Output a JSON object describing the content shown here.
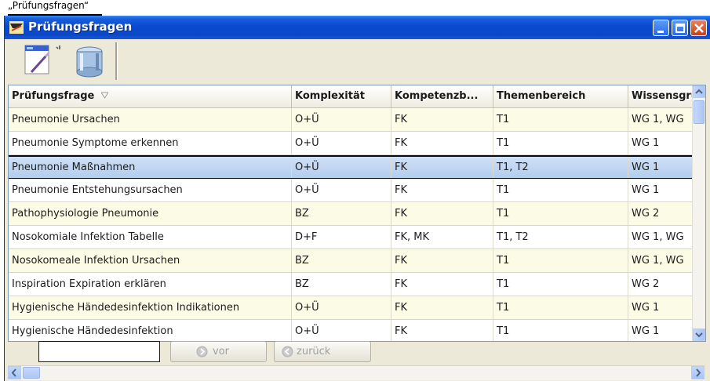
{
  "top_fragment": "„Prüfungsfragen“",
  "window": {
    "title": "Prüfungsfragen"
  },
  "toolbar": {
    "tools": [
      {
        "icon": "edit-form-icon"
      },
      {
        "icon": "database-icon"
      }
    ]
  },
  "grid": {
    "columns": [
      "Prüfungsfrage",
      "Komplexität",
      "Kompetenzb...",
      "Themenbereich",
      "Wissensgru"
    ],
    "sorted_column": "Prüfungsfrage",
    "rows": [
      [
        "Pneumonie Ursachen",
        "O+Ü",
        "FK",
        "T1",
        "WG 1, WG"
      ],
      [
        "Pneumonie Symptome erkennen",
        "O+Ü",
        "FK",
        "T1",
        "WG 1"
      ],
      [
        "Pneumonie Maßnahmen",
        "O+Ü",
        "FK",
        "T1, T2",
        "WG 1"
      ],
      [
        "Pneumonie Entstehungsursachen",
        "O+Ü",
        "FK",
        "T1",
        "WG 1"
      ],
      [
        "Pathophysiologie Pneumonie",
        "BZ",
        "FK",
        "T1",
        "WG 2"
      ],
      [
        "Nosokomiale Infektion Tabelle",
        "D+F",
        "FK, MK",
        "T1, T2",
        "WG 1, WG"
      ],
      [
        "Nosokomeale Infektion Ursachen",
        "BZ",
        "FK",
        "T1",
        "WG 1, WG"
      ],
      [
        "Inspiration Expiration erklären",
        "BZ",
        "FK",
        "T1",
        "WG 2"
      ],
      [
        "Hygienische Händedesinfektion Indikationen",
        "O+Ü",
        "FK",
        "T1",
        "WG 1"
      ],
      [
        "Hygienische Händedesinfektion",
        "O+Ü",
        "FK",
        "T1",
        "WG 1"
      ]
    ],
    "selected_row": 2
  },
  "navigation": {
    "search_value": "",
    "forward_label": "vor",
    "back_label": "zurück"
  },
  "colors": {
    "titlebar": "#0a4ad0",
    "row_alt": "#fcfbe6",
    "selection": "#b3cdee"
  }
}
